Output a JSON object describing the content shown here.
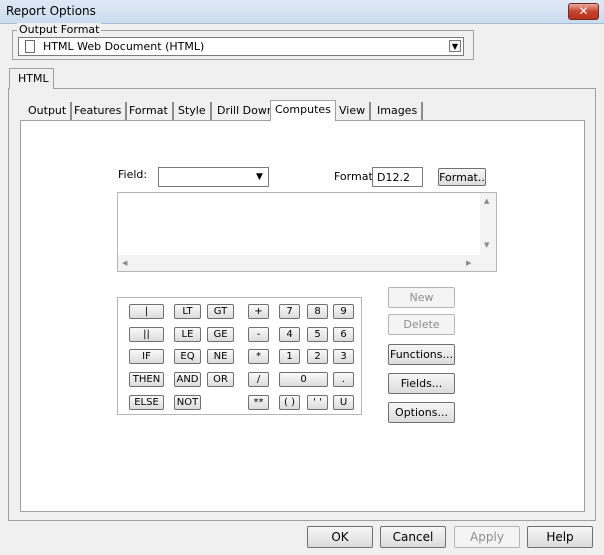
{
  "window": {
    "title": "Report Options",
    "close_glyph": "✕"
  },
  "output_format": {
    "legend": "Output Format",
    "selected": "HTML Web Document (HTML)"
  },
  "outer_tab": "HTML",
  "tabs": [
    "Output",
    "Features",
    "Format",
    "Style",
    "Drill Down",
    "Computes",
    "View",
    "Images"
  ],
  "active_tab": "Computes",
  "computes": {
    "field_label": "Field:",
    "field_value": "",
    "format_label": "Format:",
    "format_value": "D12.2",
    "format_button": "Format..",
    "expression": ""
  },
  "keypad": {
    "row1": [
      "|",
      "LT",
      "GT",
      "+",
      "7",
      "8",
      "9"
    ],
    "row2": [
      "||",
      "LE",
      "GE",
      "-",
      "4",
      "5",
      "6"
    ],
    "row3": [
      "IF",
      "EQ",
      "NE",
      "*",
      "1",
      "2",
      "3"
    ],
    "row4": [
      "THEN",
      "AND",
      "OR",
      "/",
      "0",
      "."
    ],
    "row5": [
      "ELSE",
      "NOT",
      "**",
      "( )",
      "' '",
      "U"
    ]
  },
  "side_buttons": {
    "new": "New",
    "delete": "Delete",
    "functions": "Functions...",
    "fields": "Fields...",
    "options": "Options..."
  },
  "footer": {
    "ok": "OK",
    "cancel": "Cancel",
    "apply": "Apply",
    "help": "Help"
  }
}
